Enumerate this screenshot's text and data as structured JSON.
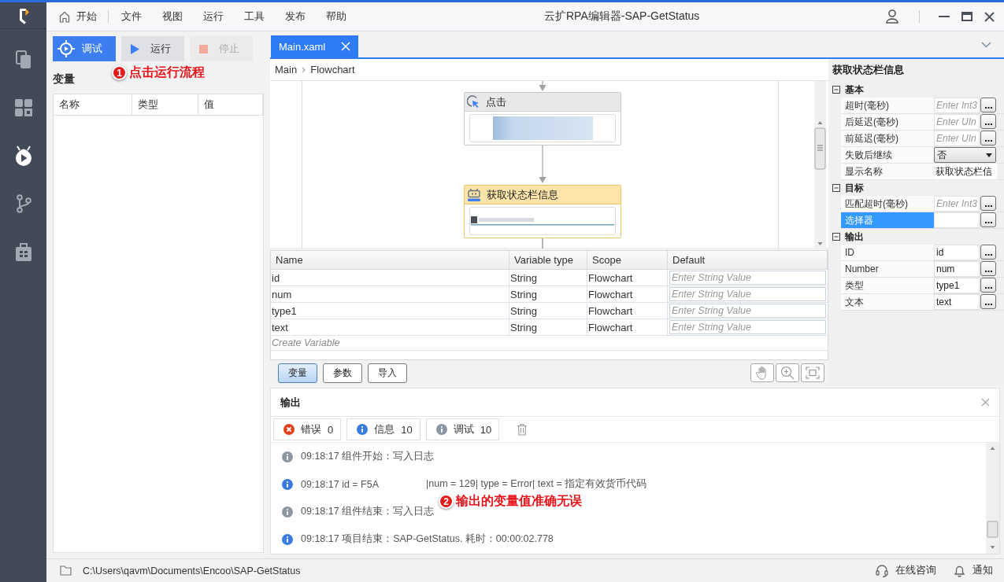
{
  "window": {
    "title": "云扩RPA编辑器-SAP-GetStatus"
  },
  "sidebar": {
    "items": [
      {
        "kind": "pages",
        "selected": false
      },
      {
        "kind": "apps",
        "selected": false
      },
      {
        "kind": "debug",
        "selected": true
      },
      {
        "kind": "branch",
        "selected": false
      },
      {
        "kind": "toolbox",
        "selected": false
      }
    ]
  },
  "menu": {
    "home": "开始",
    "items": [
      "文件",
      "视图",
      "运行",
      "工具",
      "发布",
      "帮助"
    ]
  },
  "toolbar": {
    "buttons": [
      {
        "kind": "debug",
        "label": "调试",
        "disabled": false
      },
      {
        "kind": "run",
        "label": "运行",
        "disabled": false
      },
      {
        "kind": "stop",
        "label": "停止",
        "disabled": true
      }
    ]
  },
  "annotations": [
    {
      "number": "1",
      "text": "点击运行流程"
    },
    {
      "number": "2",
      "text": "输出的变量值准确无误"
    }
  ],
  "variables_panel": {
    "title": "变量",
    "columns": [
      "名称",
      "类型",
      "值"
    ]
  },
  "editor": {
    "tabs": [
      {
        "label": "Main.xaml",
        "selected": true
      }
    ],
    "breadcrumb": [
      "Main",
      "Flowchart"
    ],
    "flowchart": {
      "nodes": [
        {
          "kind": "click",
          "title": "点击",
          "selected": false
        },
        {
          "kind": "sap",
          "title": "获取状态栏信息",
          "selected": true
        }
      ]
    },
    "variables": {
      "columns": [
        "Name",
        "Variable type",
        "Scope",
        "Default"
      ],
      "rows": [
        {
          "name": "id",
          "type": "String",
          "scope": "Flowchart",
          "placeholder": "Enter String Value"
        },
        {
          "name": "num",
          "type": "String",
          "scope": "Flowchart",
          "placeholder": "Enter String Value"
        },
        {
          "name": "type1",
          "type": "String",
          "scope": "Flowchart",
          "placeholder": "Enter String Value"
        },
        {
          "name": "text",
          "type": "String",
          "scope": "Flowchart",
          "placeholder": "Enter String Value"
        }
      ],
      "create_placeholder": "Create Variable"
    },
    "bottom_tabs": [
      {
        "label": "变量",
        "selected": true
      },
      {
        "label": "参数",
        "selected": false
      },
      {
        "label": "导入",
        "selected": false
      }
    ]
  },
  "properties": {
    "title": "获取状态栏信息",
    "sections": [
      {
        "title": "基本",
        "expanded": true,
        "rows": [
          {
            "kind": "input",
            "label": "超时(毫秒)",
            "placeholder": "Enter Int3",
            "selected": false
          },
          {
            "kind": "input",
            "label": "后延迟(毫秒)",
            "placeholder": "Enter UIn",
            "selected": false
          },
          {
            "kind": "input",
            "label": "前延迟(毫秒)",
            "placeholder": "Enter UIn",
            "selected": false
          },
          {
            "kind": "dropdown",
            "label": "失败后继续",
            "value": "否",
            "selected": false
          },
          {
            "kind": "text",
            "label": "显示名称",
            "value": "获取状态栏信",
            "selected": false
          }
        ]
      },
      {
        "title": "目标",
        "expanded": true,
        "rows": [
          {
            "kind": "input",
            "label": "匹配超时(毫秒)",
            "placeholder": "Enter Int3",
            "selected": false
          },
          {
            "kind": "input",
            "label": "选择器",
            "selected": true
          }
        ]
      },
      {
        "title": "输出",
        "expanded": true,
        "rows": [
          {
            "kind": "input",
            "label": "ID",
            "value": "id",
            "selected": false
          },
          {
            "kind": "input",
            "label": "Number",
            "value": "num",
            "selected": false
          },
          {
            "kind": "input",
            "label": "类型",
            "value": "type1",
            "selected": false
          },
          {
            "kind": "input",
            "label": "文本",
            "value": "text",
            "selected": false
          }
        ]
      }
    ]
  },
  "output": {
    "title": "输出",
    "filters": [
      {
        "kind": "error",
        "label": "错误",
        "count": "0"
      },
      {
        "kind": "info",
        "label": "信息",
        "count": "10"
      },
      {
        "kind": "debug",
        "label": "调试",
        "count": "10"
      }
    ],
    "lines": [
      {
        "kind": "debug",
        "parts": [
          "09:18:17 组件开始：写入日志"
        ]
      },
      {
        "kind": "info",
        "parts": [
          "09:18:17 id = F5A",
          "|num = 129| type = Error| text = 指定有效货币代码"
        ]
      },
      {
        "kind": "debug",
        "parts": [
          "09:18:17 组件结束：写入日志"
        ]
      },
      {
        "kind": "info",
        "parts": [
          "09:18:17 项目结束：SAP-GetStatus. 耗时：00:00:02.778"
        ]
      }
    ]
  },
  "status_bar": {
    "path": "C:\\Users\\qavm\\Documents\\Encoo\\SAP-GetStatus",
    "items": [
      {
        "kind": "support",
        "label": "在线咨询"
      },
      {
        "kind": "notify",
        "label": "通知"
      }
    ]
  }
}
